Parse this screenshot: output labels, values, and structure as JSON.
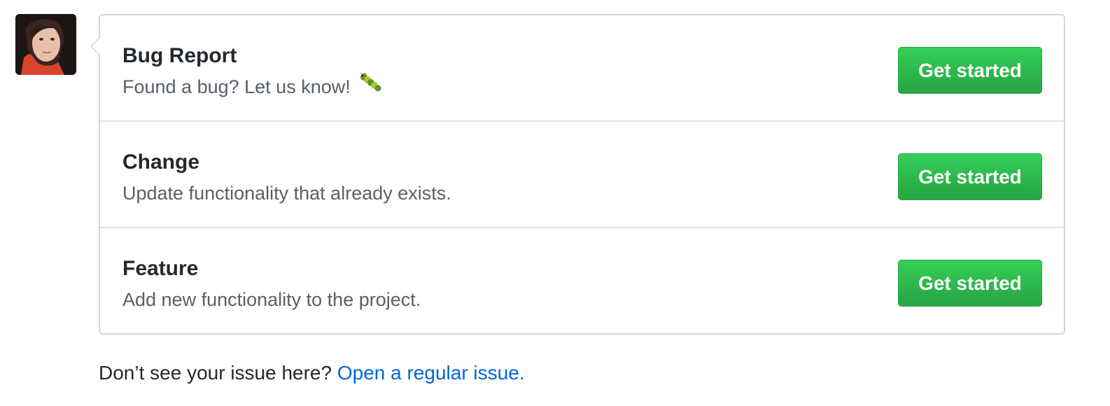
{
  "avatar": {
    "icon": "user-avatar"
  },
  "templates": [
    {
      "title": "Bug Report",
      "description": "Found a bug? Let us know!",
      "icon": "caterpillar-bug-icon",
      "button_label": "Get started"
    },
    {
      "title": "Change",
      "description": "Update functionality that already exists.",
      "button_label": "Get started"
    },
    {
      "title": "Feature",
      "description": "Add new functionality to the project.",
      "button_label": "Get started"
    }
  ],
  "footer": {
    "prompt": "Don’t see your issue here?",
    "link_label": "Open a regular issue."
  },
  "colors": {
    "button_green": "#2ea44f",
    "link_blue": "#0366d6",
    "muted_text": "#586069"
  }
}
